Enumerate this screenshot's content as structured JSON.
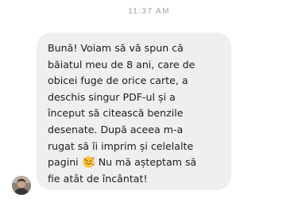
{
  "conversation": {
    "timestamp": "11:37 AM",
    "avatar_icon": "user-avatar-photo",
    "message": {
      "lines": [
        "Bună! Voiam să vă spun că",
        "băiatul meu de 8 ani, care de",
        "obicei fuge de orice carte, a",
        "deschis singur PDF-ul și a",
        "început să citească benzile",
        "desenate. După aceea m-a",
        "rugat să îi imprim și celelalte"
      ],
      "line8_before_emoji": "pagini ",
      "emoji": "smiling-face-with-hearts",
      "line8_after_emoji": " Nu mă așteptam să",
      "last_line": "fie atât de încântat!"
    },
    "colors": {
      "bubble_background": "#efeff0",
      "text": "#1c1c1c",
      "timestamp": "#a3a3a3"
    }
  }
}
